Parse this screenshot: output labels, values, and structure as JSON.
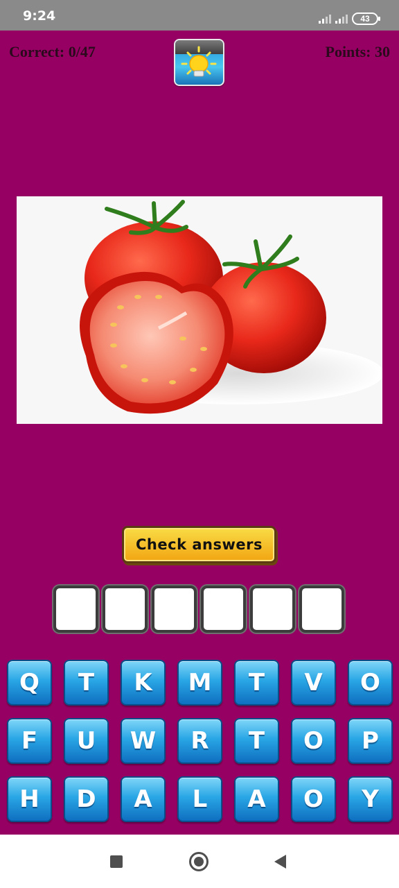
{
  "status_bar": {
    "time": "9:24",
    "battery": "43"
  },
  "header": {
    "correct": "Correct: 0/47",
    "points": "Points: 30"
  },
  "hint_button": {
    "icon": "lightbulb-icon"
  },
  "picture": {
    "subject": "tomato-image"
  },
  "check_button": {
    "label": "Check answers"
  },
  "answer_slots": [
    "",
    "",
    "",
    "",
    "",
    ""
  ],
  "keyboard": {
    "rows": [
      [
        "Q",
        "T",
        "K",
        "M",
        "T",
        "V",
        "O"
      ],
      [
        "F",
        "U",
        "W",
        "R",
        "T",
        "O",
        "P"
      ],
      [
        "H",
        "D",
        "A",
        "L",
        "A",
        "O",
        "Y"
      ]
    ]
  },
  "colors": {
    "background": "#960063",
    "key": "#29a6e5",
    "check_button": "#f2a512"
  }
}
